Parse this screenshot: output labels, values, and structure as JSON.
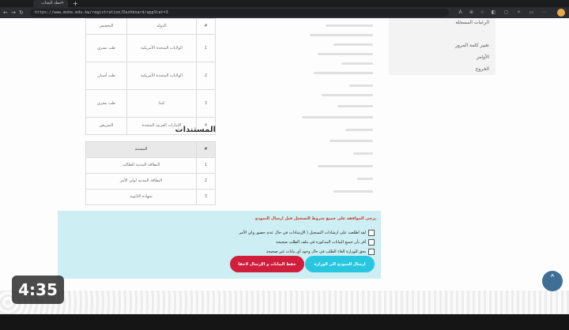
{
  "browser": {
    "tab_title": "خطة البعثات",
    "url": "https://www.mohe.edu.kw/registration/Dashboard/appStat=3"
  },
  "sidebar": {
    "items": [
      {
        "label": "الرغبات المسجلة"
      },
      {
        "label": "تغيير كلمة المرور"
      },
      {
        "label": "الأوامر"
      },
      {
        "label": "الخروج"
      }
    ]
  },
  "wishes_table": {
    "headers": [
      "#",
      "الدولة",
      "التخصص"
    ],
    "rows": [
      [
        "1",
        "الولايات المتحدة الأمريكية",
        "طب بشري"
      ],
      [
        "2",
        "الولايات المتحدة الأمريكية",
        "طب أسنان"
      ],
      [
        "3",
        "كندا",
        "طب بشري"
      ],
      [
        "4",
        "الإمارات العربية المتحدة",
        "التمريض"
      ]
    ]
  },
  "documents": {
    "title": "المستندات",
    "headers": [
      "#",
      "المستند"
    ],
    "rows": [
      [
        "1",
        "البطاقة المدنية للطالب"
      ],
      [
        "2",
        "البطاقة المدنية لولي الأمر"
      ],
      [
        "3",
        "شهادة الثانوية"
      ]
    ]
  },
  "confirm_panel": {
    "title": "يرجى الموافقة على جميع شروط التسجيل قبل ارسال النموذج",
    "checks": [
      "لقد اطلعت على ارشادات التسجيل ( الإرشادات في حال عدم حضور ولي الأمر",
      "أقر بأن جميع البيانات المذكورة في ملف الطلب صحيحة",
      "يحق للوزارة الغاء الطلب في حال وجود أي بيانات غير صحيحة"
    ],
    "send_button": "ارسال النموذج الى الوزارة",
    "save_button": "حفظ البيانات و الإرسال لاحقا"
  },
  "video_overlay": {
    "timestamp": "4:35"
  }
}
